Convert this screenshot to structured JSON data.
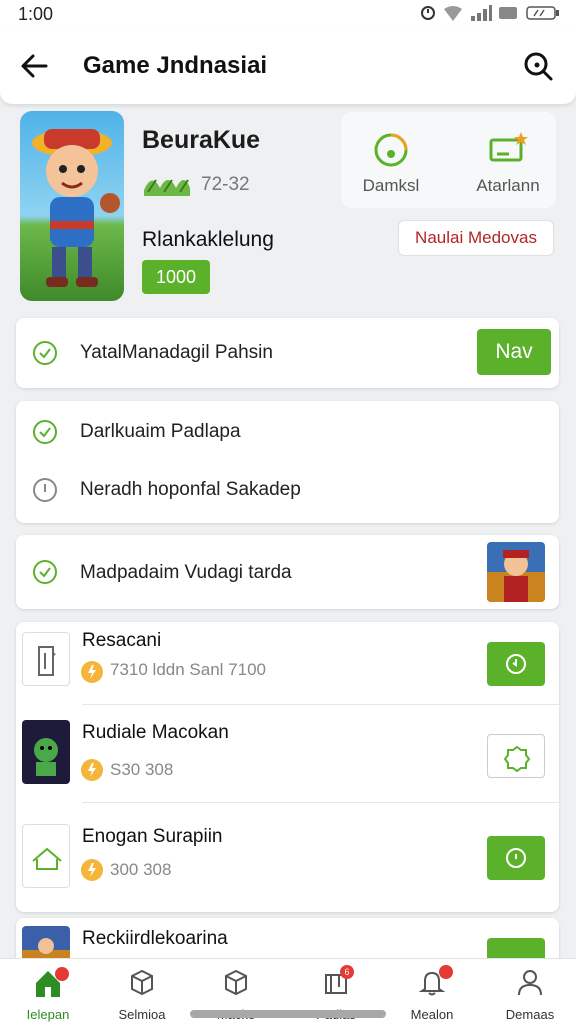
{
  "status_bar": {
    "time": "1:00"
  },
  "app_bar": {
    "title": "Game Jndnasiai"
  },
  "game": {
    "name": "BeuraKue",
    "rating": "72-32",
    "action_damksi": "Damksl",
    "action_atarlann": "Atarlann",
    "label": "Rlankaklelung",
    "price": "1000",
    "badge": "Naulai Medovas"
  },
  "rows": {
    "first": "YatalManadagil Pahsin",
    "first_button": "Nav",
    "second": "Darlkuaim Padlapa",
    "third": "Neradh hoponfal Sakadep",
    "fourth": "Madpadaim Vudagi tarda"
  },
  "items": [
    {
      "title": "Resacani",
      "sub": "7310 lddn Sanl 7100"
    },
    {
      "title": "Rudiale Macokan",
      "sub": "S30 308"
    },
    {
      "title": "Enogan Surapiin",
      "sub": "300 308"
    },
    {
      "title": "Reckiirdlekoarina",
      "sub": ""
    }
  ],
  "bottom_nav": [
    {
      "label": "Ielepan",
      "badge": ""
    },
    {
      "label": "Selmioa",
      "badge": ""
    },
    {
      "label": "Macke",
      "badge": ""
    },
    {
      "label": "Padlas",
      "badge": "6"
    },
    {
      "label": "Mealon",
      "badge": ""
    },
    {
      "label": "Demaas",
      "badge": ""
    }
  ],
  "colors": {
    "accent": "#5bb12a",
    "badge_text": "#b32525",
    "active_nav": "#2d8c22"
  }
}
